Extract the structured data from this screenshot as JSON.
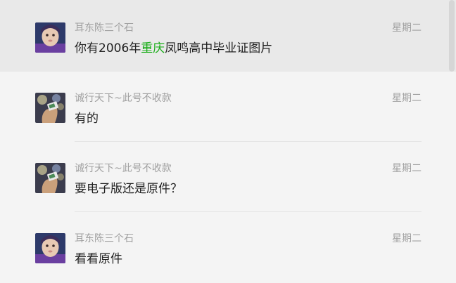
{
  "conversation": {
    "items": [
      {
        "sender": "耳东陈三个石",
        "day": "星期二",
        "message_parts": [
          "你有2006年",
          "重庆",
          "凤鸣高中毕业证图片"
        ],
        "avatar": "child-avatar",
        "selected": true
      },
      {
        "sender": "诚行天下~此号不收款",
        "day": "星期二",
        "message": "有的",
        "avatar": "hand-card-avatar"
      },
      {
        "sender": "诚行天下~此号不收款",
        "day": "星期二",
        "message": "要电子版还是原件？",
        "avatar": "hand-card-avatar"
      },
      {
        "sender": "耳东陈三个石",
        "day": "星期二",
        "message": "看看原件",
        "avatar": "child-avatar"
      }
    ]
  },
  "colors": {
    "background": "#f4f4f4",
    "selected_background": "#e9e9e9",
    "highlight_text": "#1aad19",
    "meta_text": "#a0a0a0",
    "message_text": "#222222"
  }
}
